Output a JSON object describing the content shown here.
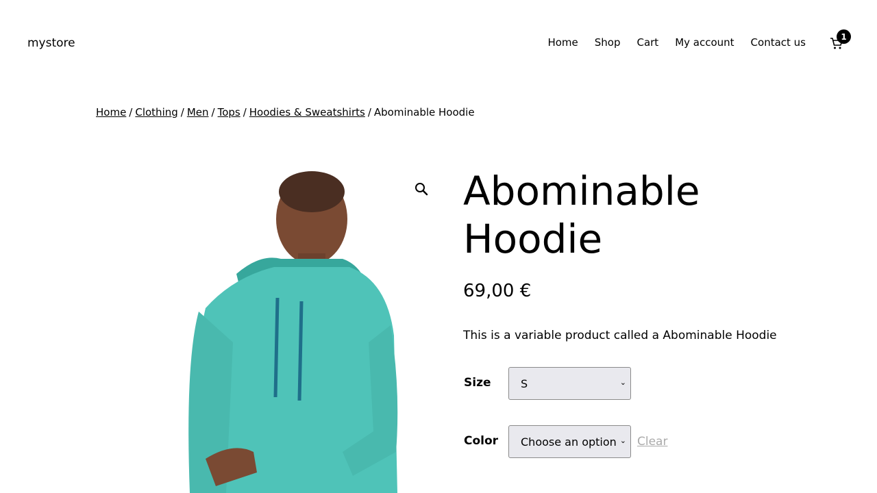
{
  "site": {
    "title": "mystore"
  },
  "nav": {
    "items": [
      {
        "label": "Home"
      },
      {
        "label": "Shop"
      },
      {
        "label": "Cart"
      },
      {
        "label": "My account"
      },
      {
        "label": "Contact us"
      }
    ],
    "cart_count": "1",
    "cart_icon": "cart-icon"
  },
  "breadcrumb": {
    "items": [
      "Home",
      "Clothing",
      "Men",
      "Tops",
      "Hoodies & Sweatshirts"
    ],
    "current": "Abominable Hoodie",
    "separator": "/"
  },
  "product": {
    "title_line1": "Abominable",
    "title_line2": "Hoodie",
    "price": "69,00 €",
    "description": "This is a variable product called a Abominable Hoodie",
    "zoom_icon": "magnifier-icon",
    "image_color": "#4fc3b8",
    "options": {
      "size_label": "Size",
      "size_value": "S",
      "color_label": "Color",
      "color_value": "Choose an option",
      "clear_label": "Clear"
    }
  },
  "colors": {
    "accent": "#000000",
    "hoodie": "#4fc3b8",
    "select_bg": "#e9e9ee"
  }
}
